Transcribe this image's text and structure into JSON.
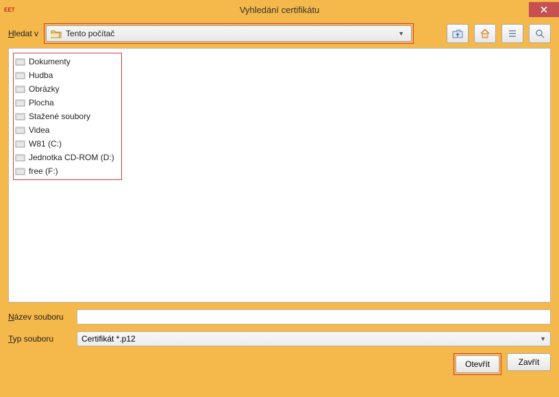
{
  "titlebar": {
    "app_badge": "EET",
    "title": "Vyhledání certifikátu"
  },
  "toolbar": {
    "lookin_label": "Hledat v",
    "location_selected": "Tento počítač"
  },
  "files": [
    {
      "label": "Dokumenty"
    },
    {
      "label": "Hudba"
    },
    {
      "label": "Obrázky"
    },
    {
      "label": "Plocha"
    },
    {
      "label": "Stažené soubory"
    },
    {
      "label": "Videa"
    },
    {
      "label": "W81 (C:)"
    },
    {
      "label": "Jednotka CD-ROM (D:)"
    },
    {
      "label": "free (F:)"
    }
  ],
  "fields": {
    "filename_label": "Název souboru",
    "filename_value": "",
    "filetype_label": "Typ souboru",
    "filetype_selected": "Certifikát *.p12"
  },
  "buttons": {
    "open": "Otevřít",
    "close": "Zavřít"
  },
  "icons": {
    "folder_open": "folder-open-icon",
    "up": "up-icon",
    "home": "home-icon",
    "list": "list-icon",
    "view": "view-icon",
    "close_x": "close-icon"
  }
}
